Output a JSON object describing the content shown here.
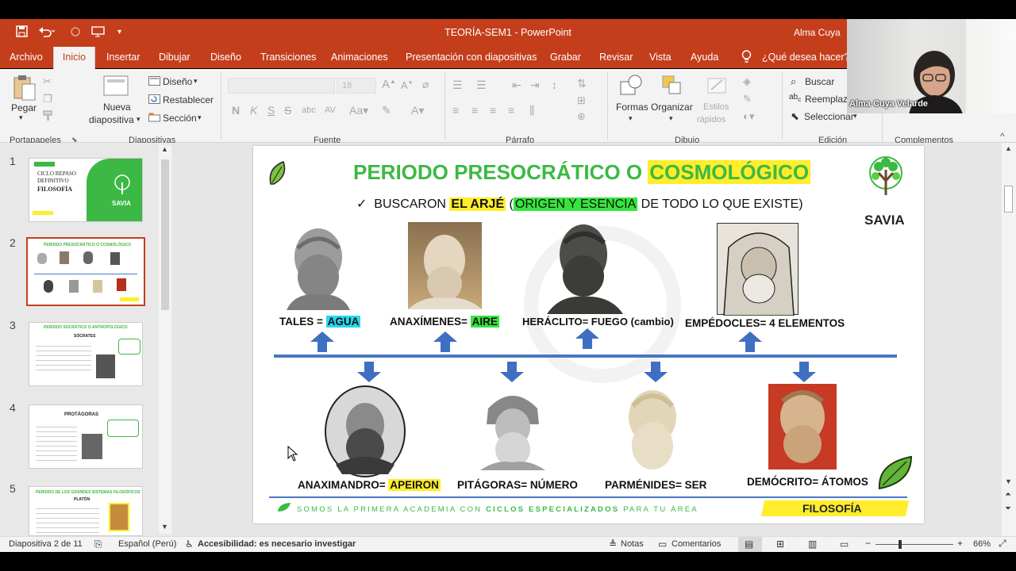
{
  "window": {
    "title": "TEORÍA-SEM1  -  PowerPoint",
    "user": "Alma Cuya"
  },
  "menu": [
    "Archivo",
    "Inicio",
    "Insertar",
    "Dibujar",
    "Diseño",
    "Transiciones",
    "Animaciones",
    "Presentación con diapositivas",
    "Grabar",
    "Revisar",
    "Vista",
    "Ayuda"
  ],
  "tell_me": "¿Qué desea hacer?",
  "ribbon": {
    "paste": "Pegar",
    "portapapeles": "Portapapeles",
    "new_slide_1": "Nueva",
    "new_slide_2": "diapositiva",
    "layout": "Diseño",
    "reset": "Restablecer",
    "section": "Sección",
    "diapositivas": "Diapositivas",
    "font_size": "18",
    "fuente": "Fuente",
    "parrafo": "Párrafo",
    "shapes": "Formas",
    "arrange": "Organizar",
    "styles_1": "Estilos",
    "styles_2": "rápidos",
    "dibujo": "Dibujo",
    "find": "Buscar",
    "replace": "Reemplazar",
    "select": "Seleccionar",
    "edicion": "Edición",
    "complementos": "Complementos"
  },
  "webcam": {
    "name": "Alma Cuya Velarde"
  },
  "thumbnails": [
    {
      "num": "1",
      "line1": "CICLO REPASO",
      "line2": "DEFINITIVO",
      "line3": "FILOSOFÍA",
      "brand": "SAVIA"
    },
    {
      "num": "2",
      "title": "PERIODO PRESOCRÁTICO O COSMOLÓGICO"
    },
    {
      "num": "3",
      "title": "PERIODO SOCRÁTICO O ANTROPOLÓGICO",
      "sub": "SÓCRATES"
    },
    {
      "num": "4",
      "title": "PROTÁGORAS"
    },
    {
      "num": "5",
      "title": "PERIODO DE LOS GRANDES SISTEMAS FILOSÓFICOS",
      "sub": "PLATÓN"
    }
  ],
  "slide": {
    "title_part1": "PERIODO PRESOCRÁTICO O ",
    "title_part2": "COSMOLÓGICO",
    "subtitle_check": "✓",
    "subtitle_a": "BUSCARON ",
    "subtitle_b": "EL ARJÉ",
    "subtitle_c": " (",
    "subtitle_d": "ORIGEN Y ESENCIA",
    "subtitle_e": " DE TODO LO QUE EXISTE)",
    "brand": "SAVIA",
    "top": [
      {
        "label_a": "TALES = ",
        "label_b": "AGUA"
      },
      {
        "label_a": "ANAXÍMENES= ",
        "label_b": "AIRE"
      },
      {
        "label_a": "HERÁCLITO= FUEGO (cambio)",
        "label_b": ""
      },
      {
        "label_a": "EMPÉDOCLES= 4 ELEMENTOS",
        "label_b": ""
      }
    ],
    "bottom": [
      {
        "label_a": "ANAXIMANDRO= ",
        "label_b": "APEIRON"
      },
      {
        "label_a": "PITÁGORAS= NÚMERO",
        "label_b": ""
      },
      {
        "label_a": "PARMÉNIDES= SER",
        "label_b": ""
      },
      {
        "label_a": "DEMÓCRITO= ÁTOMOS",
        "label_b": ""
      }
    ],
    "footer_a": "SOMOS LA PRIMERA ACADEMIA CON ",
    "footer_b": "CICLOS ESPECIALIZADOS",
    "footer_c": " PARA TU ÁREA",
    "footer_tag": "FILOSOFÍA"
  },
  "status": {
    "slide_of": "Diapositiva 2 de 11",
    "language": "Español (Perú)",
    "accessibility": "Accesibilidad: es necesario investigar",
    "notes": "Notas",
    "comments": "Comentarios",
    "zoom": "66%"
  },
  "colors": {
    "accent": "#c43e1c",
    "green": "#3cb944",
    "blue": "#4a78c2",
    "yellow": "#ffed2c"
  }
}
